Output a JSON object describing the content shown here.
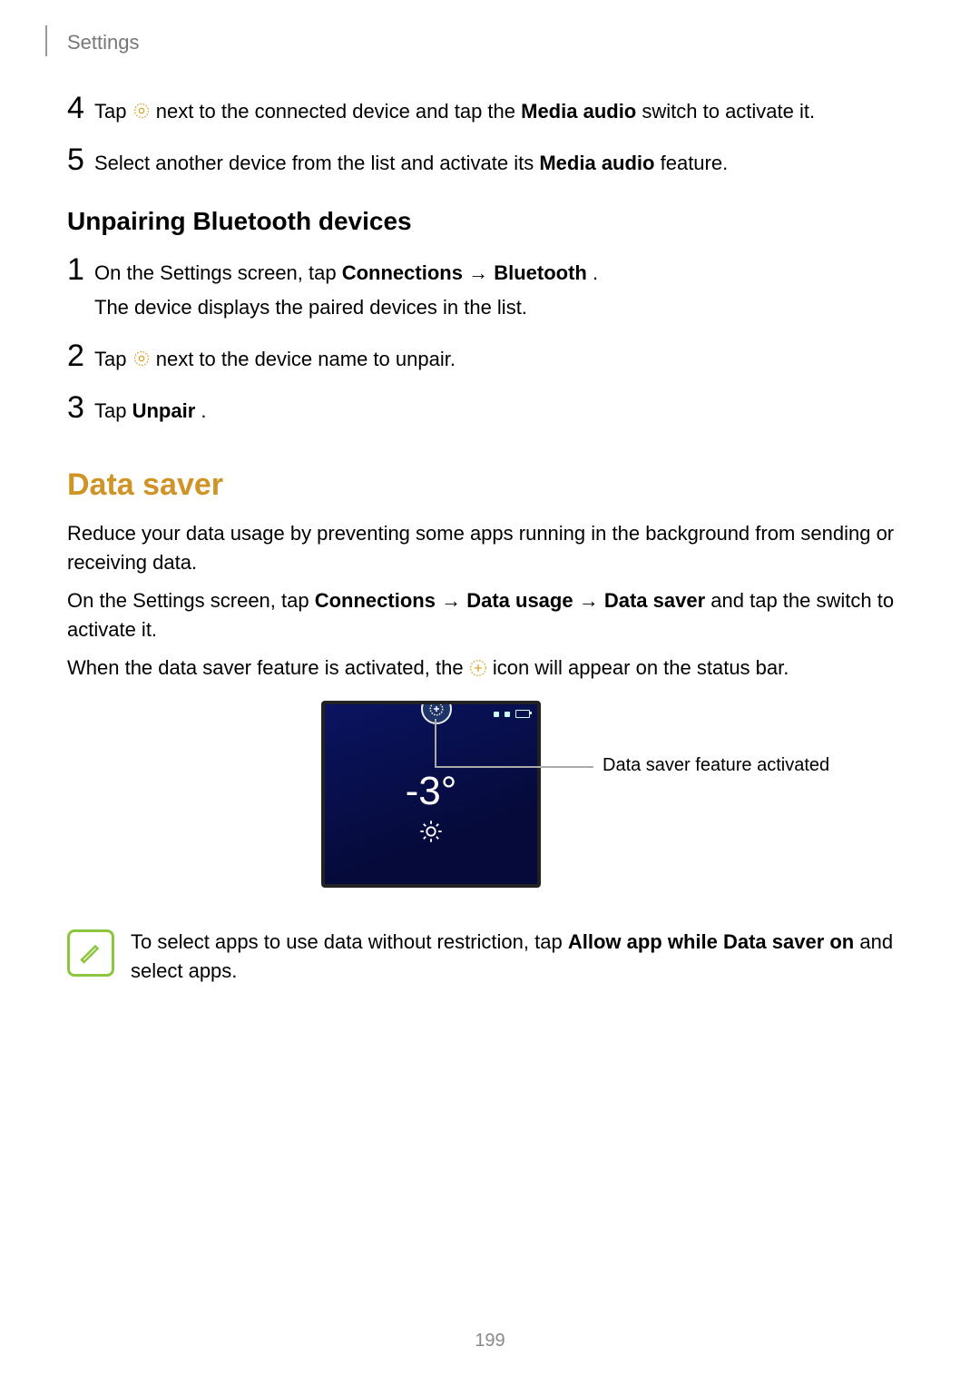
{
  "header": "Settings",
  "steps_top": {
    "s4": {
      "num": "4",
      "pre": "Tap ",
      "post_before_bold": " next to the connected device and tap the ",
      "bold": "Media audio",
      "post_after_bold": " switch to activate it."
    },
    "s5": {
      "num": "5",
      "pre": "Select another device from the list and activate its ",
      "bold": "Media audio",
      "post": " feature."
    }
  },
  "unpair": {
    "heading": "Unpairing Bluetooth devices",
    "s1": {
      "num": "1",
      "line1_pre": "On the Settings screen, tap ",
      "line1_b1": "Connections",
      "line1_arrow": " → ",
      "line1_b2": "Bluetooth",
      "line1_post": ".",
      "line2": "The device displays the paired devices in the list."
    },
    "s2": {
      "num": "2",
      "pre": "Tap ",
      "post": " next to the device name to unpair."
    },
    "s3": {
      "num": "3",
      "pre": "Tap ",
      "bold": "Unpair",
      "post": "."
    }
  },
  "datasaver": {
    "heading": "Data saver",
    "p1": "Reduce your data usage by preventing some apps running in the background from sending or receiving data.",
    "p2_pre": "On the Settings screen, tap ",
    "p2_b1": "Connections",
    "p2_arr1": " → ",
    "p2_b2": "Data usage",
    "p2_arr2": " → ",
    "p2_b3": "Data saver",
    "p2_post": " and tap the switch to activate it.",
    "p3_pre": "When the data saver feature is activated, the ",
    "p3_post": " icon will appear on the status bar.",
    "figure": {
      "temperature": "-3°",
      "callout": "Data saver feature activated"
    },
    "note_pre": "To select apps to use data without restriction, tap ",
    "note_bold": "Allow app while Data saver on",
    "note_post": " and select apps."
  },
  "page_number": "199"
}
